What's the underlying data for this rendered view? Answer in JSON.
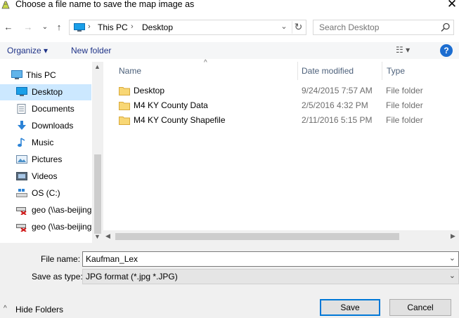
{
  "titlebar": {
    "title": "Choose a file name to save the map image as",
    "close_glyph": "✕"
  },
  "nav": {
    "back_glyph": "←",
    "forward_glyph": "→",
    "recent_glyph": "⌄",
    "up_glyph": "↑",
    "address": {
      "icon": "pc-icon",
      "segments": [
        "This PC",
        "Desktop"
      ]
    },
    "refresh_glyph": "↻",
    "search_placeholder": "Search Desktop"
  },
  "toolbar": {
    "organize_label": "Organize ▾",
    "new_folder_label": "New folder",
    "view_glyph": "☷ ▾",
    "help_glyph": "?"
  },
  "sidebar": {
    "items": [
      {
        "label": "This PC",
        "icon": "pc-icon",
        "selected": false
      },
      {
        "label": "Desktop",
        "icon": "desktop-icon",
        "selected": true
      },
      {
        "label": "Documents",
        "icon": "documents-icon",
        "selected": false
      },
      {
        "label": "Downloads",
        "icon": "downloads-icon",
        "selected": false
      },
      {
        "label": "Music",
        "icon": "music-icon",
        "selected": false
      },
      {
        "label": "Pictures",
        "icon": "pictures-icon",
        "selected": false
      },
      {
        "label": "Videos",
        "icon": "videos-icon",
        "selected": false
      },
      {
        "label": "OS (C:)",
        "icon": "drive-icon",
        "selected": false
      },
      {
        "label": "geo (\\\\as-beijing",
        "icon": "network-drive-disconnected-icon",
        "selected": false
      },
      {
        "label": "geo (\\\\as-beijing",
        "icon": "network-drive-disconnected-icon",
        "selected": false
      }
    ]
  },
  "filelist": {
    "columns": {
      "name": "Name",
      "date": "Date modified",
      "type": "Type"
    },
    "sort_glyph": "^",
    "rows": [
      {
        "name": "Desktop",
        "date": "9/24/2015 7:57 AM",
        "type": "File folder",
        "icon": "folder-icon"
      },
      {
        "name": "M4 KY County Data",
        "date": "2/5/2016 4:32 PM",
        "type": "File folder",
        "icon": "folder-icon"
      },
      {
        "name": "M4 KY County Shapefile",
        "date": "2/11/2016 5:15 PM",
        "type": "File folder",
        "icon": "folder-icon"
      }
    ]
  },
  "form": {
    "filename_label": "File name:",
    "filename_value": "Kaufman_Lex",
    "savetype_label": "Save as type:",
    "savetype_value": "JPG format (*.jpg *.JPG)"
  },
  "buttons": {
    "save": "Save",
    "cancel": "Cancel",
    "hide_folders": "Hide Folders",
    "hide_folders_glyph": "^"
  },
  "colors": {
    "accent": "#0078d7",
    "selection": "#cce8ff",
    "folder": "#f8d775",
    "link_text": "#1e3287"
  }
}
